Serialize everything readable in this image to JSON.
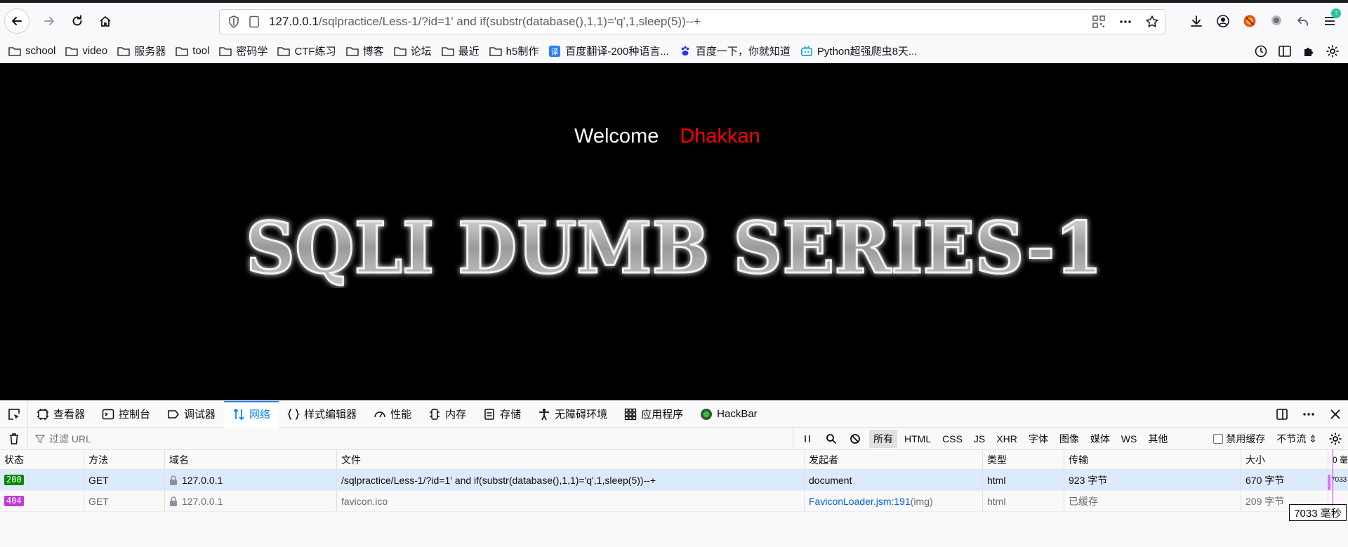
{
  "browser": {
    "url_host": "127.0.0.1",
    "url_path": "/sqlpractice/Less-1/?id=1' and if(substr(database(),1,1)='q',1,sleep(5))--+"
  },
  "bookmarks": [
    {
      "label": "school",
      "icon": "folder-icon"
    },
    {
      "label": "video",
      "icon": "folder-icon"
    },
    {
      "label": "服务器",
      "icon": "folder-icon"
    },
    {
      "label": "tool",
      "icon": "folder-icon"
    },
    {
      "label": "密码学",
      "icon": "folder-icon"
    },
    {
      "label": "CTF练习",
      "icon": "folder-icon"
    },
    {
      "label": "博客",
      "icon": "folder-icon"
    },
    {
      "label": "论坛",
      "icon": "folder-icon"
    },
    {
      "label": "最近",
      "icon": "folder-icon"
    },
    {
      "label": "h5制作",
      "icon": "folder-icon"
    },
    {
      "label": "百度翻译-200种语言...",
      "icon": "translate-icon"
    },
    {
      "label": "百度一下，你就知道",
      "icon": "baidu-paw-icon"
    },
    {
      "label": "Python超强爬虫8天...",
      "icon": "bilibili-icon"
    }
  ],
  "page": {
    "welcome": "Welcome",
    "name": "Dhakkan",
    "banner": "SQLI DUMB SERIES-1"
  },
  "devtools": {
    "tabs": [
      {
        "label": "查看器",
        "icon": "inspector-icon"
      },
      {
        "label": "控制台",
        "icon": "console-icon"
      },
      {
        "label": "调试器",
        "icon": "debugger-icon"
      },
      {
        "label": "网络",
        "icon": "network-icon",
        "active": true
      },
      {
        "label": "样式编辑器",
        "icon": "style-editor-icon"
      },
      {
        "label": "性能",
        "icon": "performance-icon"
      },
      {
        "label": "内存",
        "icon": "memory-icon"
      },
      {
        "label": "存储",
        "icon": "storage-icon"
      },
      {
        "label": "无障碍环境",
        "icon": "accessibility-icon"
      },
      {
        "label": "应用程序",
        "icon": "application-icon"
      },
      {
        "label": "HackBar",
        "icon": "hackbar-icon"
      }
    ],
    "filter_placeholder": "过滤 URL",
    "type_filters": [
      "所有",
      "HTML",
      "CSS",
      "JS",
      "XHR",
      "字体",
      "图像",
      "媒体",
      "WS",
      "其他"
    ],
    "disable_cache": "禁用缓存",
    "throttle": "不节流 ⇕",
    "columns": [
      "状态",
      "方法",
      "域名",
      "文件",
      "发起者",
      "类型",
      "传输",
      "大小",
      "0 毫"
    ],
    "rows": [
      {
        "status": "200",
        "method": "GET",
        "domain": "127.0.0.1",
        "file": "/sqlpractice/Less-1/?id=1' and if(substr(database(),1,1)='q',1,sleep(5))--+",
        "initiator": "document",
        "initiator_suffix": "",
        "type": "html",
        "transferred": "923 字节",
        "size": "670 字节",
        "waterfall": "7033"
      },
      {
        "status": "404",
        "method": "GET",
        "domain": "127.0.0.1",
        "file": "favicon.ico",
        "initiator": "FaviconLoader.jsm:191",
        "initiator_suffix": " (img)",
        "type": "html",
        "transferred": "已缓存",
        "size": "209 字节",
        "waterfall": ""
      }
    ],
    "timing_tooltip": "7033 毫秒"
  },
  "colors": {
    "accent": "#0a84ff",
    "name_red": "#ff0000",
    "status_ok": "#058b00",
    "status_404": "#c13ad7"
  }
}
